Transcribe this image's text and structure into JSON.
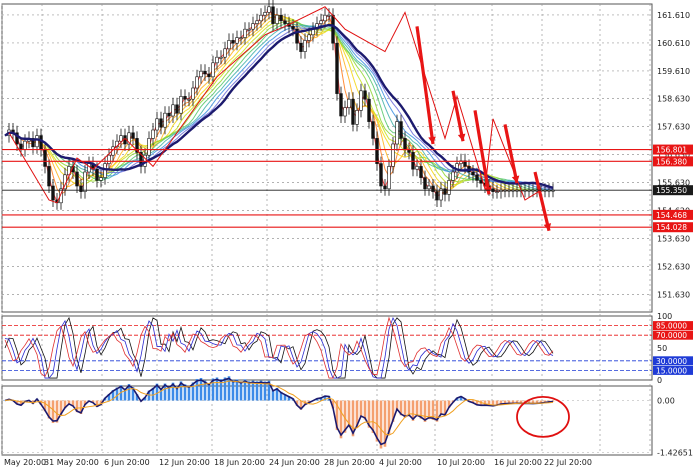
{
  "chart_data": [
    {
      "type": "candlestick",
      "panel": "price",
      "x_tick_labels": [
        "May 20:00",
        "31 May 20:00",
        "6 Jun 20:00",
        "12 Jun 20:00",
        "18 Jun 20:00",
        "24 Jun 20:00",
        "28 Jun 20:00",
        "4 Jul 20:00",
        "10 Jul 20:00",
        "16 Jul 20:00",
        "22 Jul 20:00"
      ],
      "y_tick_labels": [
        "161.610",
        "160.610",
        "159.610",
        "158.630",
        "157.630",
        "156.630",
        "155.630",
        "154.620",
        "153.630",
        "152.630",
        "151.630"
      ],
      "ylim": [
        151.0,
        162.0
      ],
      "series": [
        {
          "name": "",
          "x": [
            0,
            4,
            8,
            12,
            16,
            20,
            24,
            28,
            32,
            36,
            40,
            44,
            48,
            52,
            56,
            60,
            64,
            68,
            72,
            76,
            80,
            84,
            88,
            92,
            96,
            100,
            104,
            108,
            112,
            116,
            120,
            124,
            128,
            132,
            136,
            140,
            144,
            148,
            152,
            156,
            160,
            164,
            168,
            172,
            176,
            180,
            184,
            188,
            192,
            196,
            200,
            204,
            208,
            212,
            216,
            220,
            224,
            228,
            232,
            236,
            240,
            244,
            248,
            252,
            256,
            260,
            264,
            268,
            272,
            276,
            280,
            284,
            288,
            292,
            296,
            300,
            304,
            308,
            312,
            316,
            320,
            324,
            328,
            332,
            336,
            340,
            344,
            348,
            352,
            356,
            360,
            364,
            368,
            372,
            376,
            380,
            384,
            388,
            392,
            396,
            400,
            404,
            408,
            412,
            416,
            420,
            424,
            428,
            432,
            436,
            440,
            444,
            448,
            452,
            456,
            460,
            464,
            468,
            472,
            476,
            480,
            484,
            488,
            492,
            496,
            500,
            504,
            508,
            512,
            516,
            520,
            524,
            528,
            532,
            536,
            540,
            544,
            548
          ],
          "values": [
            157.3,
            157.5,
            157.4,
            157.0,
            156.8,
            157.1,
            157.2,
            156.9,
            157.3,
            156.8,
            156.2,
            155.5,
            155.0,
            154.9,
            155.4,
            155.9,
            156.2,
            156.0,
            155.5,
            155.3,
            156.0,
            156.3,
            156.1,
            155.7,
            155.8,
            156.3,
            156.6,
            156.9,
            157.1,
            157.3,
            157.0,
            157.4,
            157.2,
            156.7,
            156.2,
            156.6,
            157.2,
            157.5,
            157.9,
            157.6,
            158.1,
            158.0,
            158.4,
            158.1,
            158.7,
            158.6,
            158.6,
            159.0,
            159.4,
            159.6,
            159.5,
            159.4,
            159.9,
            160.1,
            160.1,
            160.4,
            160.7,
            160.6,
            160.8,
            160.8,
            161.1,
            161.1,
            161.3,
            161.4,
            161.6,
            161.7,
            161.9,
            161.3,
            161.6,
            161.4,
            161.3,
            161.2,
            161.1,
            160.6,
            160.3,
            160.7,
            160.9,
            161.1,
            161.3,
            161.4,
            161.6,
            161.6,
            160.6,
            158.8,
            158.0,
            158.3,
            158.6,
            157.7,
            158.2,
            158.9,
            158.6,
            157.8,
            157.2,
            156.3,
            155.5,
            155.4,
            156.2,
            157.0,
            157.8,
            157.2,
            156.8,
            156.7,
            156.1,
            156.2,
            155.8,
            155.4,
            155.5,
            155.3,
            155.0,
            155.4,
            155.2,
            155.7,
            156.0,
            156.3,
            156.4,
            156.2,
            156.0,
            155.9,
            155.7,
            155.6,
            155.5,
            155.4,
            155.3,
            155.3,
            155.35,
            155.35,
            155.35,
            155.35,
            155.35,
            155.35,
            155.35,
            155.35,
            155.35,
            155.35,
            155.35,
            155.35,
            155.35,
            155.35
          ]
        }
      ],
      "horizontal_levels": [
        {
          "value": "156.801",
          "color": "#e81515"
        },
        {
          "value": "156.380",
          "color": "#e81515"
        },
        {
          "value": "155.350",
          "color": "#1a1a1a"
        },
        {
          "value": "154.468",
          "color": "#e81515"
        },
        {
          "value": "154.028",
          "color": "#e81515"
        }
      ],
      "grid": true
    },
    {
      "type": "line",
      "panel": "oscillator",
      "y_tick_labels": [
        "100",
        "85.0000",
        "70.0000",
        "50",
        "30.0000",
        "15.0000",
        "0"
      ],
      "ylim": [
        0,
        100
      ],
      "levels": [
        {
          "value": "85.0000",
          "color": "#e81515"
        },
        {
          "value": "70.0000",
          "color": "#e81515"
        },
        {
          "value": "30.0000",
          "color": "#1f3bd6"
        },
        {
          "value": "15.0000",
          "color": "#1f3bd6"
        }
      ]
    },
    {
      "type": "bar",
      "panel": "histogram",
      "y_tick_labels": [
        "0.00",
        "-1.42651"
      ],
      "ylim": [
        -1.5,
        0.4
      ]
    }
  ]
}
